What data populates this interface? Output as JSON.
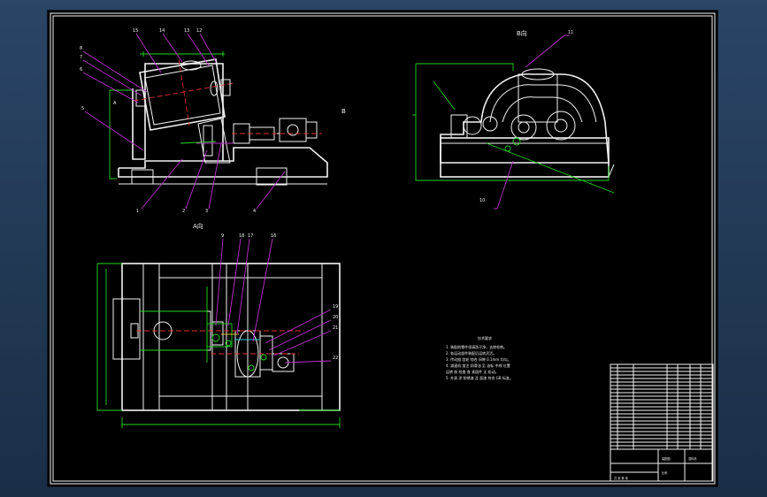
{
  "drawing": {
    "view_labels": {
      "side_b": "B",
      "view_b_title": "B向",
      "view_a_title": "A向"
    },
    "tech_requirements": {
      "title": "技术要求",
      "lines": [
        "1. 装配前零件须清洗干净，去除毛刺。",
        "2. 各运动部件装配后运转灵活。",
        "3. 传动链 齿轮 啮合 间隙 0.1mm 均匀。",
        "4. 减速机 加注 润滑油 至 油标 中线 位置",
        "   运转 前 检查 各 紧固件 无 松动。",
        "5. 外表 涂 防锈漆 及 面漆 符合 GB 标准。"
      ]
    },
    "title_block": {
      "drawing_name": "混料机",
      "company": "装配图",
      "scale_label": "比例",
      "sheet_label": "共 张 第 张"
    }
  }
}
